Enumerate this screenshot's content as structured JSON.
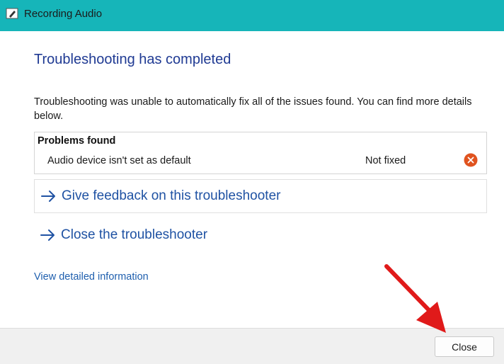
{
  "window": {
    "title": "Recording Audio"
  },
  "main": {
    "heading": "Troubleshooting has completed",
    "description": "Troubleshooting was unable to automatically fix all of the issues found. You can find more details below.",
    "problems": {
      "header": "Problems found",
      "rows": [
        {
          "name": "Audio device isn't set as default",
          "status": "Not fixed",
          "status_icon": "error-x-icon"
        }
      ]
    },
    "links": {
      "feedback": "Give feedback on this troubleshooter",
      "close_troubleshooter": "Close the troubleshooter",
      "detailed_info": "View detailed information"
    }
  },
  "footer": {
    "close_label": "Close"
  },
  "colors": {
    "titlebar": "#16b5b9",
    "heading": "#1f3a93",
    "link": "#1f52a3",
    "error": "#e0531f",
    "annotation": "#e01a1a"
  }
}
